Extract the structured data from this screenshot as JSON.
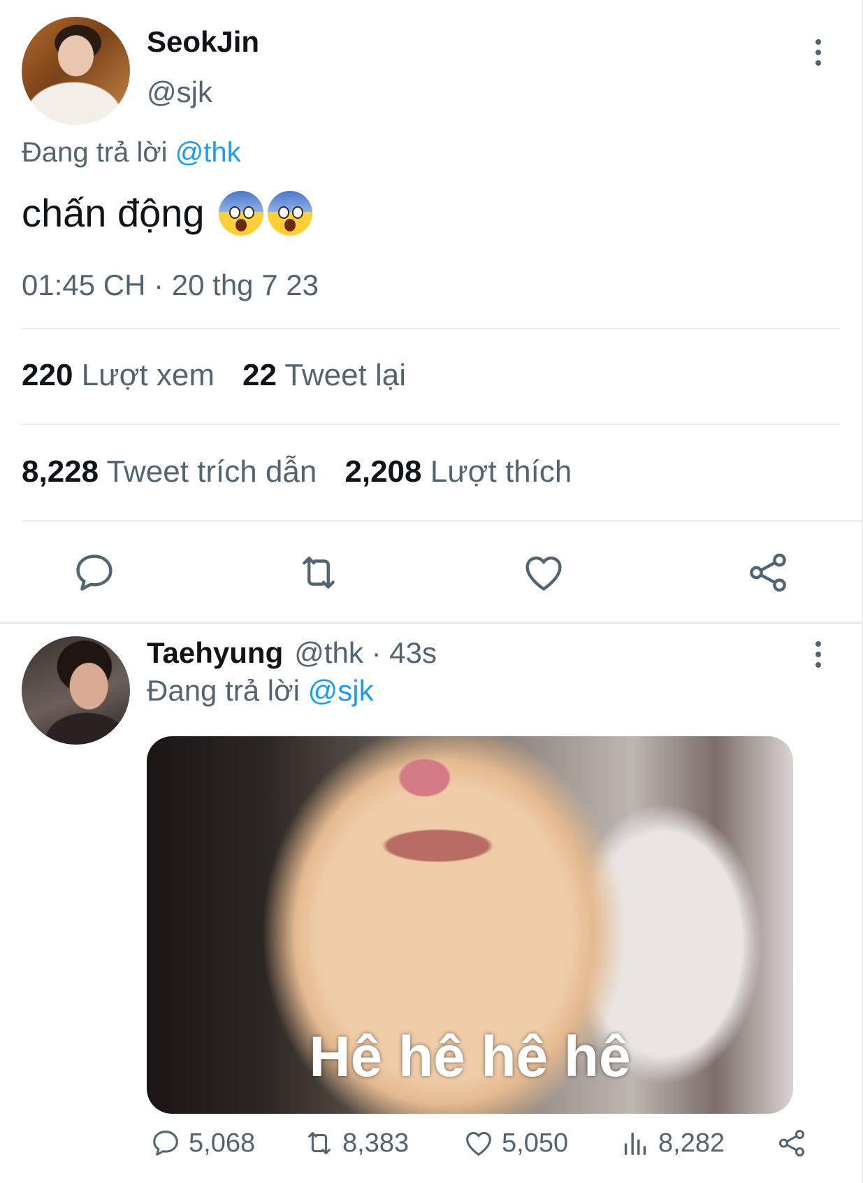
{
  "main_tweet": {
    "name": "SeokJin",
    "handle": "@sjk",
    "replying_prefix": "Đang trả lời",
    "replying_to": "@thk",
    "text": "chấn động",
    "emoji": [
      "face-screaming-in-fear",
      "face-screaming-in-fear"
    ],
    "timestamp": "01:45 CH · 20 thg 7 23",
    "stats": {
      "views_count": "220",
      "views_label": "Lượt xem",
      "retweets_count": "22",
      "retweets_label": "Tweet lại",
      "quotes_count": "8,228",
      "quotes_label": "Tweet trích dẫn",
      "likes_count": "2,208",
      "likes_label": "Lượt thích"
    },
    "actions": [
      "reply-icon",
      "retweet-icon",
      "like-icon",
      "share-icon"
    ]
  },
  "reply_tweet": {
    "name": "Taehyung",
    "meta": "@thk · 43s",
    "replying_prefix": "Đang trả lời",
    "replying_to": "@sjk",
    "media_caption": "Hê hê hê hê",
    "actions": {
      "replies": "5,068",
      "retweets": "8,383",
      "likes": "5,050",
      "views": "8,282"
    }
  },
  "colors": {
    "text_primary": "#0f1419",
    "text_secondary": "#536471",
    "link": "#1d9bf0",
    "divider": "#e6ecf0"
  }
}
